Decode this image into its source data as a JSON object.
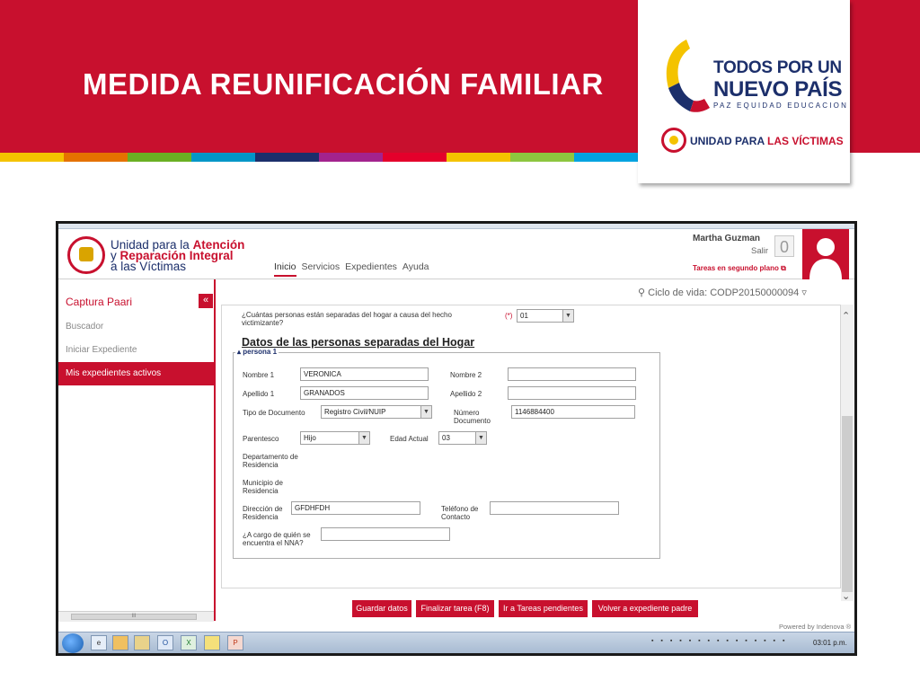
{
  "slide": {
    "title": "MEDIDA REUNIFICACIÓN FAMILIAR",
    "stripe_colors": [
      "#f4c300",
      "#e57200",
      "#6ab023",
      "#0096c7",
      "#1c2f6b",
      "#a3238e",
      "#e4002b",
      "#f4c300",
      "#8dc63f",
      "#00a3e0"
    ],
    "logo": {
      "line1": "TODOS POR UN",
      "line2": "NUEVO PAÍS",
      "tagline": "PAZ  EQUIDAD  EDUCACION",
      "unidad_prefix": "UNIDAD PARA ",
      "unidad_suffix": "LAS VÍCTIMAS"
    }
  },
  "app": {
    "org": {
      "line1_a": "Unidad para la ",
      "line1_b": "Atención",
      "line2_a": "y ",
      "line2_b": "Reparación Integral",
      "line3": "a las Víctimas"
    },
    "nav": [
      "Inicio",
      "Servicios",
      "Expedientes",
      "Ayuda"
    ],
    "user": {
      "name": "Martha Guzman",
      "logout": "Salir",
      "task_count": "0",
      "background_tasks": "Tareas en segundo plano"
    },
    "sidebar": {
      "title": "Captura Paari",
      "collapse": "«",
      "items": [
        "Buscador",
        "Iniciar Expediente",
        "Mis expedientes activos"
      ],
      "scroll_label": "III"
    },
    "lifecycle": "Ciclo de vida: CODP20150000094",
    "form": {
      "question": "¿Cuántas personas están separadas del hogar a causa del hecho victimizante?",
      "required_mark": "(*)",
      "question_value": "01",
      "section_title": "Datos de las personas separadas del Hogar",
      "legend": "persona 1",
      "fields": {
        "nombre1_label": "Nombre 1",
        "nombre1_value": "VERONICA",
        "nombre2_label": "Nombre 2",
        "nombre2_value": "",
        "apellido1_label": "Apellido 1",
        "apellido1_value": "GRANADOS",
        "apellido2_label": "Apellido 2",
        "apellido2_value": "",
        "tipo_doc_label": "Tipo de Documento",
        "tipo_doc_value": "Registro Civil/NUIP",
        "num_doc_label": "Número Documento",
        "num_doc_value": "1146884400",
        "parentesco_label": "Parentesco",
        "parentesco_value": "Hijo",
        "edad_label": "Edad Actual",
        "edad_value": "03",
        "depto_label": "Departamento de Residencia",
        "municipio_label": "Municipio de Residencia",
        "direccion_label": "Dirección de Residencia",
        "direccion_value": "GFDHFDH",
        "telefono_label": "Teléfono de Contacto",
        "telefono_value": "",
        "cargo_label": "¿A cargo de quién se encuentra el NNA?",
        "cargo_value": ""
      }
    },
    "buttons": [
      "Guardar datos",
      "Finalizar tarea (F8)",
      "Ir a Tareas pendientes",
      "Volver a expediente padre"
    ],
    "powered_by": "Powered by Indenova ®",
    "taskbar": {
      "icons": [
        "e",
        "",
        "",
        "O",
        "X",
        "",
        "P"
      ],
      "clock": "03:01 p.m."
    }
  },
  "colors": {
    "brand_red": "#c8102e",
    "navy": "#1c2f6b"
  }
}
